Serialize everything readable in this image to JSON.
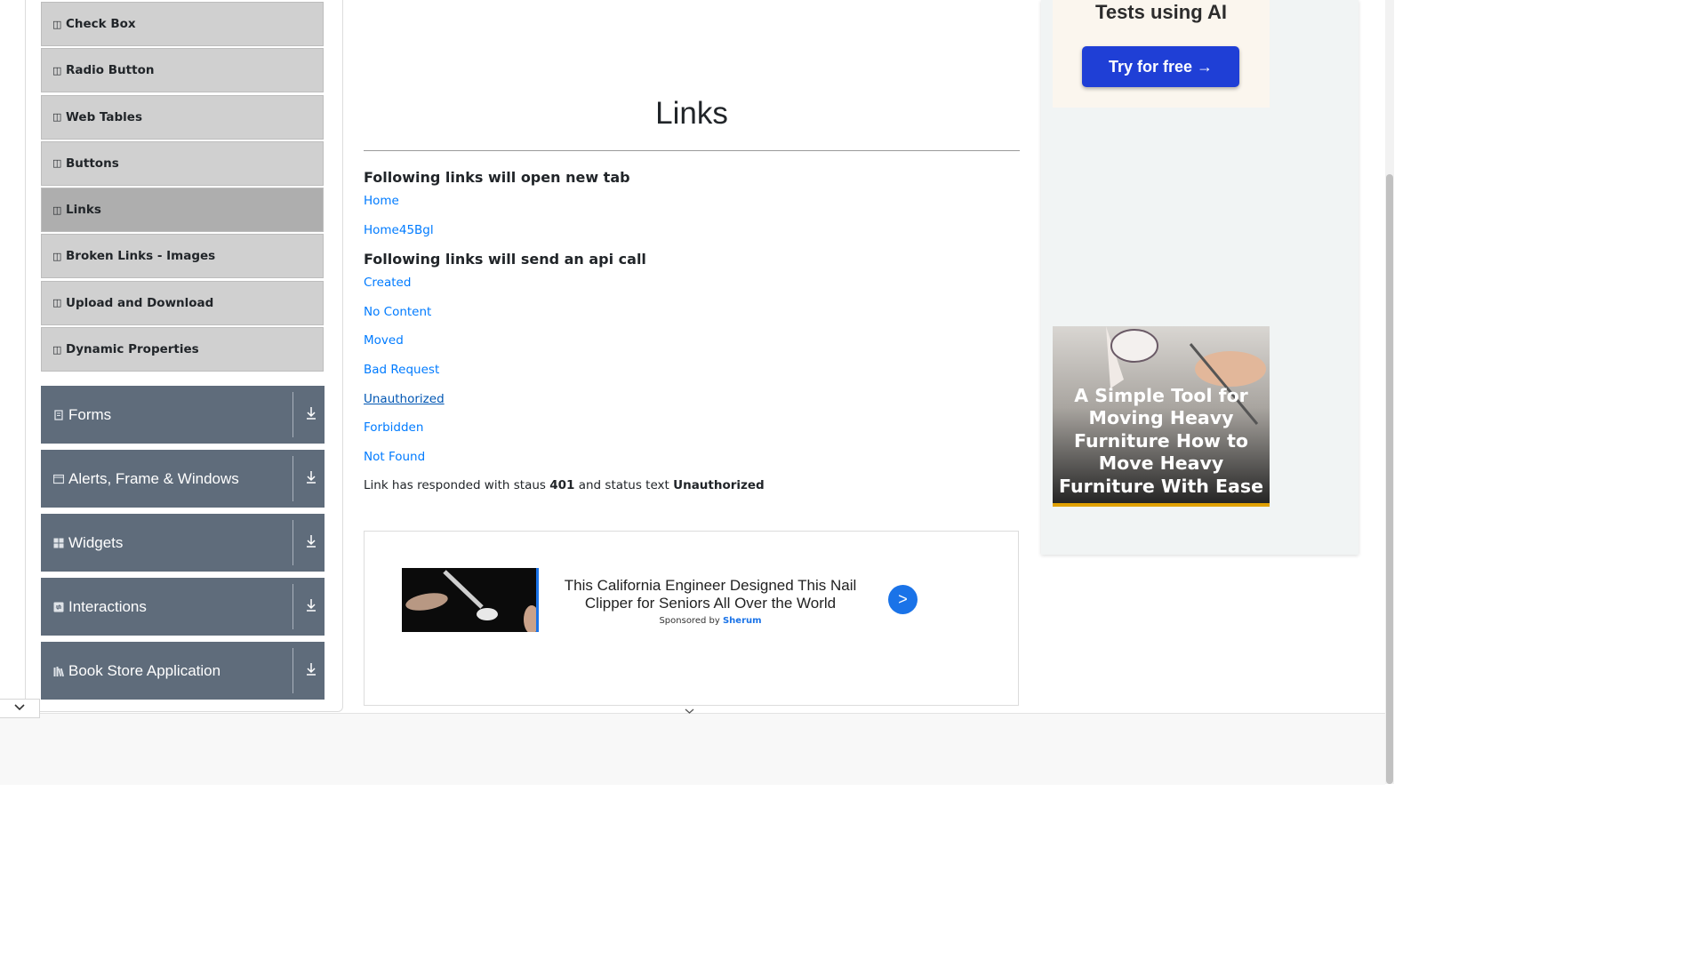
{
  "sidebar": {
    "items": [
      {
        "label": "Check Box",
        "active": false
      },
      {
        "label": "Radio Button",
        "active": false
      },
      {
        "label": "Web Tables",
        "active": false
      },
      {
        "label": "Buttons",
        "active": false
      },
      {
        "label": "Links",
        "active": true
      },
      {
        "label": "Broken Links - Images",
        "active": false
      },
      {
        "label": "Upload and Download",
        "active": false
      },
      {
        "label": "Dynamic Properties",
        "active": false
      }
    ],
    "groups": [
      {
        "label": "Forms",
        "icon": "document-icon"
      },
      {
        "label": "Alerts, Frame & Windows",
        "icon": "window-icon"
      },
      {
        "label": "Widgets",
        "icon": "widgets-icon"
      },
      {
        "label": "Interactions",
        "icon": "interactions-icon"
      },
      {
        "label": "Book Store Application",
        "icon": "book-icon"
      }
    ]
  },
  "main": {
    "title": "Links",
    "new_tab_heading": "Following links will open new tab",
    "new_tab_links": [
      "Home",
      "Home45Bgl"
    ],
    "api_heading": "Following links will send an api call",
    "api_links": [
      "Created",
      "No Content",
      "Moved",
      "Bad Request",
      "Unauthorized",
      "Forbidden",
      "Not Found"
    ],
    "response": {
      "prefix": "Link has responded with staus",
      "status_code": "401",
      "middle": "and status text",
      "status_text": "Unauthorized"
    }
  },
  "bottom_ad": {
    "headline": "This California Engineer Designed This Nail Clipper for Seniors All Over the World",
    "sponsored_prefix": "Sponsored by",
    "sponsor": "Sherum",
    "go_label": ">"
  },
  "right_ad": {
    "top_text": "Tests using AI",
    "button_label": "Try for free →",
    "furniture_text": "A Simple Tool for Moving Heavy Furniture How to Move Heavy Furniture With Ease"
  },
  "colors": {
    "link": "#007bff",
    "group_bg": "#5f6c7b",
    "menu_bg": "#d0d0d0",
    "menu_active_bg": "#aeaeae",
    "ad_button": "#1f3fd6"
  }
}
